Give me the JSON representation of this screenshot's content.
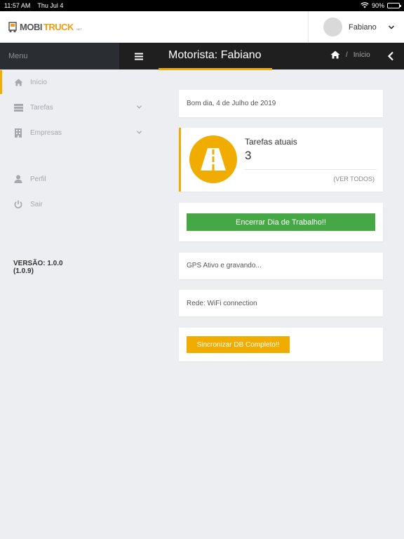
{
  "status_bar": {
    "time": "11:57 AM",
    "date": "Thu Jul 4",
    "battery": "90%",
    "battery_level": 0.9
  },
  "header": {
    "logo": {
      "brand_part1": "MOBI",
      "brand_part2": "TRUCK",
      "brand_suffix": ".NET"
    },
    "user_name": "Fabiano"
  },
  "navbar": {
    "menu_label": "Menu",
    "page_title": "Motorista: Fabiano",
    "breadcrumb": {
      "separator": "/",
      "current": "Início"
    }
  },
  "sidebar": {
    "items": [
      {
        "label": "Início",
        "icon": "home-icon",
        "active": true
      },
      {
        "label": "Tarefas",
        "icon": "list-icon",
        "has_submenu": true
      },
      {
        "label": "Empresas",
        "icon": "building-icon",
        "has_submenu": true
      },
      {
        "label": "Perfil",
        "icon": "user-icon"
      },
      {
        "label": "Sair",
        "icon": "power-icon"
      }
    ],
    "version_line1": "VERSÃO: 1.0.0",
    "version_line2": "(1.0.9)"
  },
  "main": {
    "greeting": "Bom dia, 4 de Julho de 2019",
    "tasks": {
      "label": "Tarefas atuais",
      "count": "3",
      "link": "(VER TODOS)",
      "icon": "road-icon"
    },
    "end_day_button": "Encerrar Dia de Trabalho!!",
    "gps_status": "GPS Ativo e gravando...",
    "network_status": "Rede: WiFi connection",
    "sync_button": "Sincronizar DB Completo!!"
  },
  "colors": {
    "accent": "#f0ad00",
    "success": "#45a845",
    "nav_dark": "#1f1f1f",
    "background": "#eceef1"
  }
}
